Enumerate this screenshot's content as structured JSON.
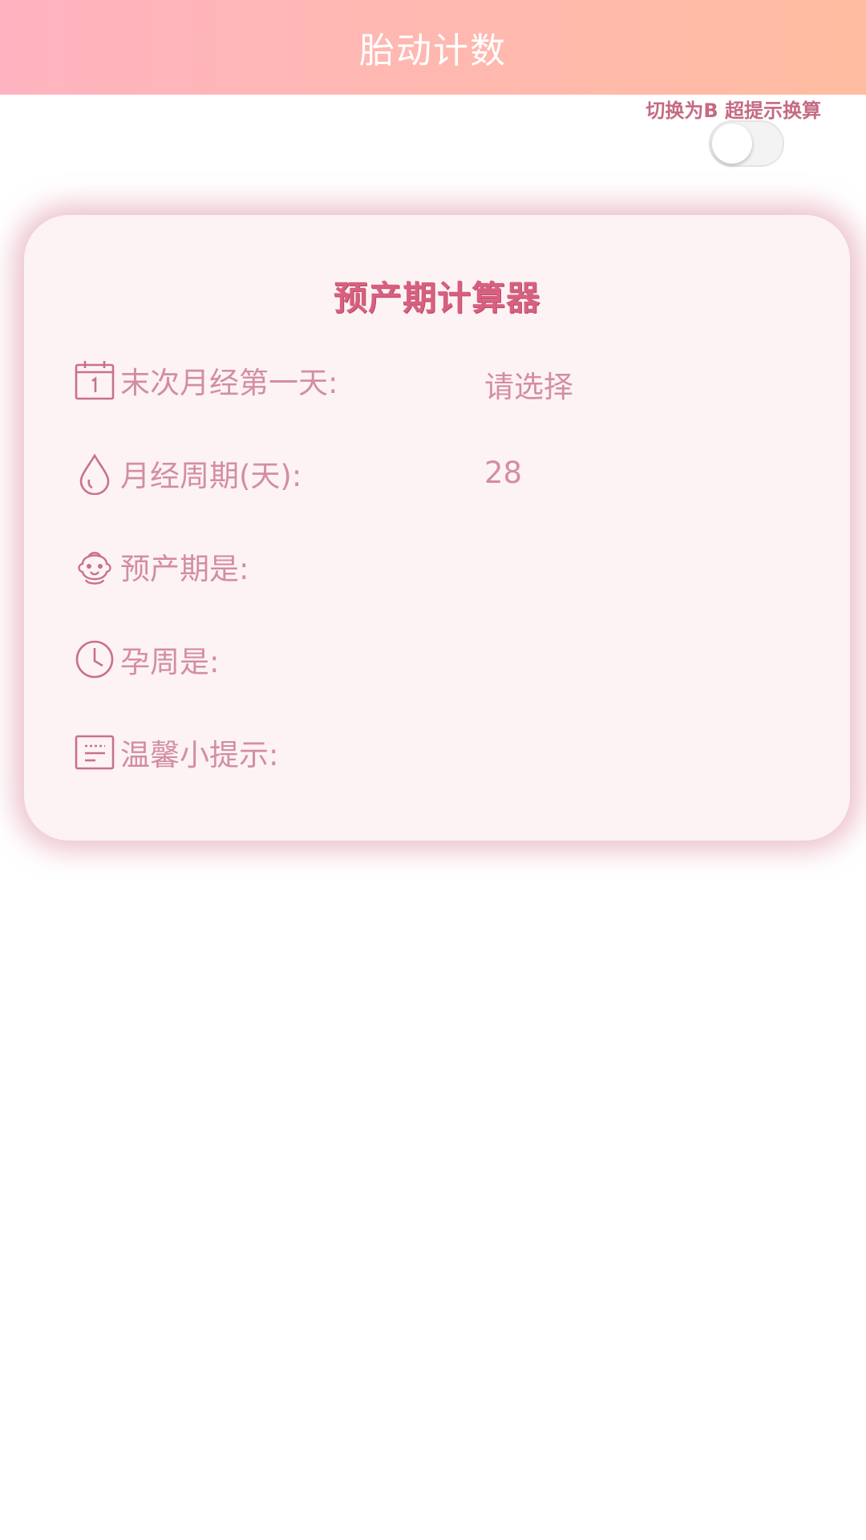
{
  "header": {
    "title": "胎动计数"
  },
  "toggle": {
    "label": "切换为B 超提示换算",
    "state": "off"
  },
  "card": {
    "title": "预产期计算器",
    "rows": [
      {
        "icon": "calendar-icon",
        "label": "末次月经第一天:",
        "value": "请选择"
      },
      {
        "icon": "drop-icon",
        "label": "月经周期(天):",
        "value": "28"
      },
      {
        "icon": "baby-face-icon",
        "label": "预产期是:",
        "value": ""
      },
      {
        "icon": "clock-icon",
        "label": "孕周是:",
        "value": ""
      },
      {
        "icon": "note-icon",
        "label": "温馨小提示:",
        "value": ""
      }
    ]
  },
  "colors": {
    "header_gradient_start": "#ffb3c0",
    "header_gradient_end": "#ffbca0",
    "accent": "#d8607f",
    "text": "#d38ea2",
    "icon": "#c9718b",
    "card_background": "#fdf3f5"
  }
}
